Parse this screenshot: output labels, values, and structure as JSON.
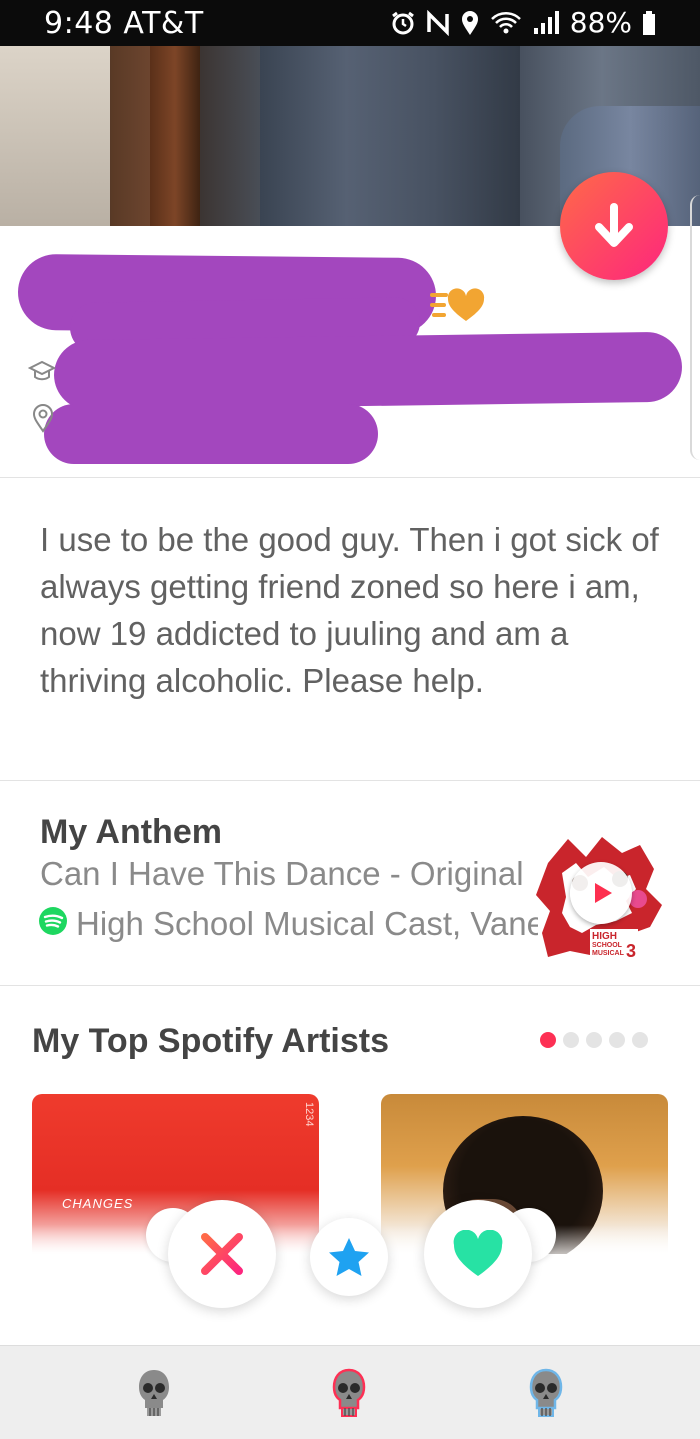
{
  "status_bar": {
    "time": "9:48 AT&T",
    "battery": "88%"
  },
  "profile": {
    "bio": "I use to be the good guy. Then i got sick of always getting friend zoned so here i am, now 19 addicted to juuling and am a thriving alcoholic. Please help."
  },
  "anthem": {
    "title": "My Anthem",
    "song": "Can I Have This Dance - Original",
    "artist": "High School Musical Cast, Vanessa Hudgens"
  },
  "album_art": {
    "text_lines": [
      "HIGH",
      "SCHOOL",
      "MUSICAL",
      "3"
    ]
  },
  "top_artists": {
    "title": "My Top Spotify Artists",
    "page_count": 5,
    "active_page": 1,
    "card_texts": [
      "CHANGES",
      "1234"
    ]
  },
  "icons": {
    "down_button": "arrow-down-icon",
    "education": "graduation-cap-icon",
    "location": "location-pin-icon",
    "spotify": "spotify-icon",
    "play": "play-icon",
    "nope": "x-icon",
    "super_like": "star-icon",
    "like": "heart-icon",
    "nav": [
      "skull-icon",
      "skull-icon",
      "skull-icon"
    ]
  },
  "colors": {
    "brand_gradient_start": "#ff6a48",
    "brand_gradient_end": "#fd267d",
    "redaction": "#a347be",
    "super_like": "#1fa2f1",
    "like": "#27e2a4",
    "spotify": "#1ed760"
  }
}
